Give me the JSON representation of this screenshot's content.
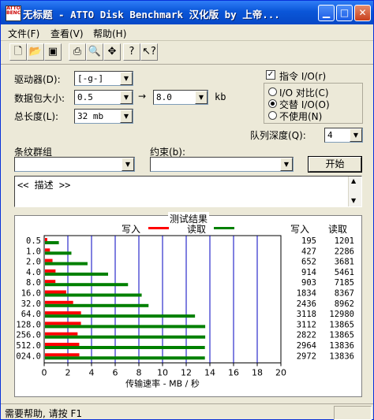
{
  "window": {
    "title": "无标题 - ATTO Disk Benchmark  汉化版 by 上帝...",
    "app_icon_text": "ATTO BENCH"
  },
  "menu": [
    "文件(F)",
    "查看(V)",
    "帮助(H)"
  ],
  "settings": {
    "drive_label": "驱动器(D):",
    "drive_value": "[-g-]",
    "transfer_label": "数据包大小:",
    "transfer_from": "0.5",
    "arrow": "→",
    "transfer_to": "8.0",
    "transfer_unit": "kb",
    "length_label": "总长度(L):",
    "length_value": "32 mb",
    "direct_io_label": "指令 I/O(r)",
    "direct_io_checked": true,
    "io_compare_label": "I/O 对比(C)",
    "overlapped_io_label": "交替 I/O(O)",
    "neither_label": "不使用(N)",
    "selected_io": "overlapped",
    "queue_label": "队列深度(Q):",
    "queue_value": "4",
    "stripe_label": "条纹群组",
    "stripe_value": "",
    "constraint_label": "约束(b):",
    "constraint_value": "",
    "start_label": "开始"
  },
  "description": {
    "text": "<< 描述 >>"
  },
  "results": {
    "title": "测试结果",
    "write_legend": "写入",
    "read_legend": "读取",
    "write_header": "写入",
    "read_header": "读取",
    "write_color": "#ff0000",
    "read_color": "#008000"
  },
  "status": {
    "text": "需要帮助, 请按 F1"
  },
  "chart_data": {
    "type": "bar",
    "orientation": "horizontal",
    "categories": [
      "0.5",
      "1.0",
      "2.0",
      "4.0",
      "8.0",
      "16.0",
      "32.0",
      "64.0",
      "128.0",
      "256.0",
      "512.0",
      "024.0"
    ],
    "series": [
      {
        "name": "写入",
        "color": "#ff0000",
        "values": [
          195,
          427,
          652,
          914,
          903,
          1834,
          2436,
          3118,
          3112,
          2822,
          2964,
          2972
        ]
      },
      {
        "name": "读取",
        "color": "#008000",
        "values": [
          1201,
          2286,
          3681,
          5461,
          7185,
          8367,
          8962,
          12980,
          13865,
          13865,
          13836,
          13836
        ]
      }
    ],
    "x_ticks": [
      "0",
      "2",
      "4",
      "6",
      "8",
      "10",
      "12",
      "14",
      "16",
      "18",
      "20"
    ],
    "xlim": [
      0,
      20
    ],
    "xlabel": "传输速率 - MB / 秒",
    "grid": true
  }
}
